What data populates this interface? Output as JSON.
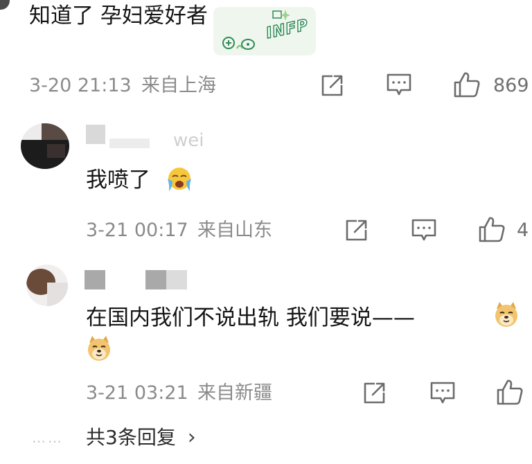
{
  "top_comment": {
    "text": "知道了 孕妇爱好者",
    "sticker_text": "INFP",
    "time": "3-20 21:13",
    "location": "来自上海",
    "like_count": "869"
  },
  "replies": [
    {
      "username_partial": "wei",
      "text": "我喷了",
      "emoji": "loudly-crying-face",
      "time": "3-21 00:17",
      "location": "来自山东",
      "like_count": "4"
    },
    {
      "text": "在国内我们不说出轨  我们要说——",
      "emoji": "doge",
      "time": "3-21 03:21",
      "location": "来自新疆",
      "like_count": ""
    }
  ],
  "more_replies": {
    "dots": "……",
    "label": "共3条回复",
    "chevron": "›"
  },
  "icons": {
    "share": "share-icon",
    "comment": "comment-icon",
    "like": "thumbs-up-icon"
  },
  "colors": {
    "text": "#151515",
    "meta": "#8a8a8a",
    "sticker_green": "#2e8b57",
    "emoji_yellow": "#f7c63d"
  }
}
